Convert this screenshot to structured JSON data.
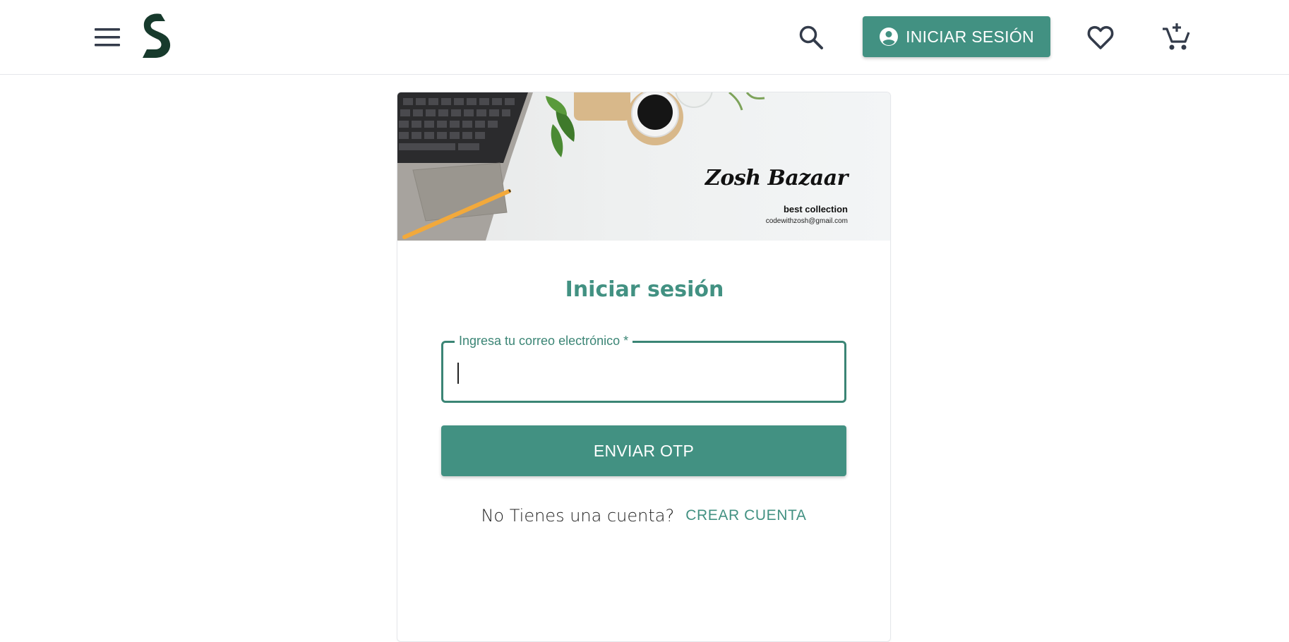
{
  "colors": {
    "accent": "#429182",
    "field_border": "#3b8575",
    "icon": "#333b4a",
    "logo": "#173a2c"
  },
  "header": {
    "menu_icon": "menu-icon",
    "logo_icon": "brand-s-logo",
    "search_icon": "search-icon",
    "login_label": "INICIAR SESIÓN",
    "login_icon": "account-circle-icon",
    "favorites_icon": "heart-icon",
    "cart_icon": "add-shopping-cart-icon"
  },
  "banner": {
    "brand": "Zosh Bazaar",
    "tagline": "best collection",
    "email": "codewithzosh@gmail.com"
  },
  "form": {
    "title": "Iniciar sesión",
    "email_label": "Ingresa tu correo electrónico *",
    "email_value": "",
    "submit_label": "ENVIAR OTP",
    "signup_prompt": "No Tienes una cuenta?",
    "signup_link": "CREAR CUENTA"
  }
}
